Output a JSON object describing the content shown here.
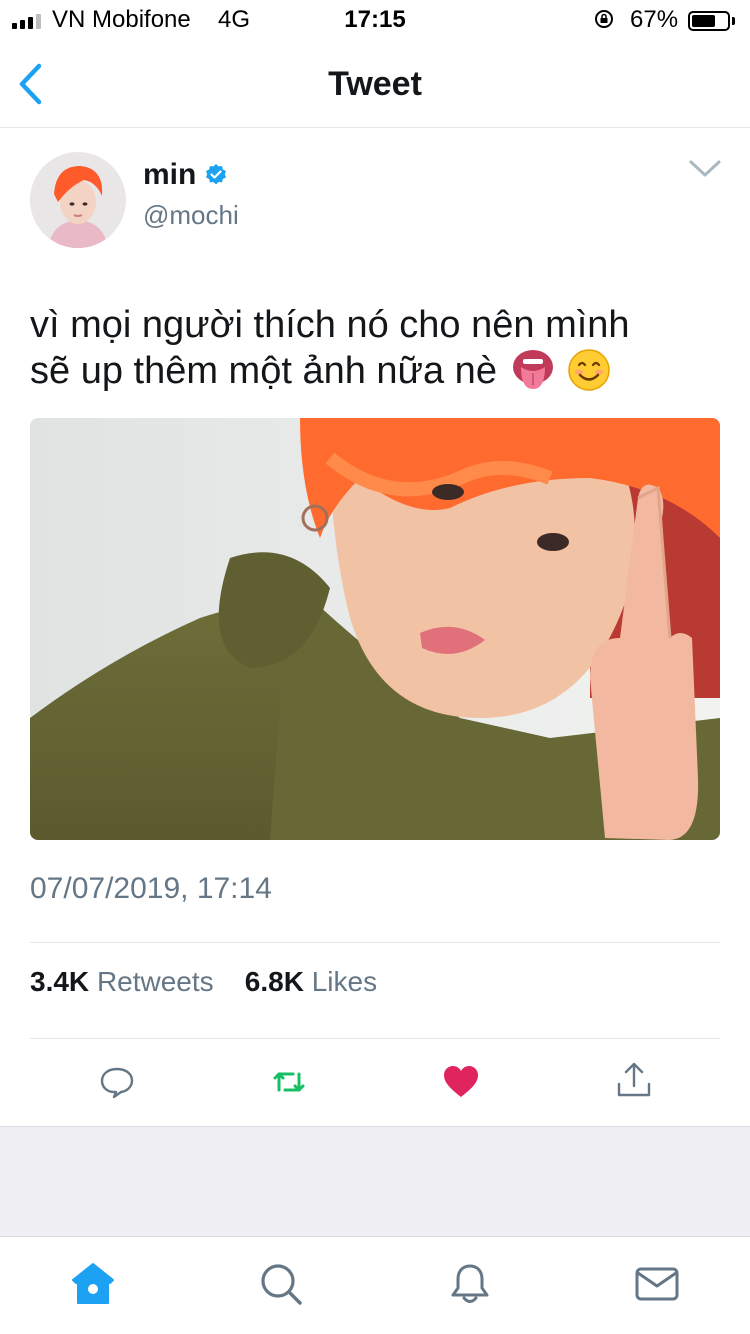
{
  "status_bar": {
    "carrier": "VN Mobifone",
    "network": "4G",
    "time": "17:15",
    "battery_percent": "67%",
    "battery_level": 0.67,
    "icons": [
      "signal-icon",
      "rotation-lock-icon",
      "battery-icon"
    ]
  },
  "nav": {
    "title": "Tweet",
    "back_icon": "chevron-left-icon"
  },
  "author": {
    "name": "min",
    "handle": "@mochi",
    "verified": true,
    "menu_icon": "chevron-down-icon"
  },
  "tweet": {
    "text_line1": "vì mọi người thích nó cho nên mình",
    "text_line2": "sẽ up thêm một ảnh nữa nè",
    "emojis": [
      "tongue-face-emoji",
      "smiling-face-emoji"
    ],
    "timestamp": "07/07/2019, 17:14"
  },
  "stats": {
    "retweets_count": "3.4K",
    "retweets_label": "Retweets",
    "likes_count": "6.8K",
    "likes_label": "Likes"
  },
  "actions": [
    {
      "icon": "reply-icon"
    },
    {
      "icon": "retweet-icon",
      "color": "#17bf63"
    },
    {
      "icon": "heart-icon",
      "color": "#e0245e"
    },
    {
      "icon": "share-icon"
    }
  ],
  "tab_bar": [
    {
      "icon": "home-icon",
      "active": true,
      "color": "#1da1f2"
    },
    {
      "icon": "search-icon"
    },
    {
      "icon": "notifications-bell-icon"
    },
    {
      "icon": "messages-envelope-icon"
    }
  ],
  "colors": {
    "accent": "#1da1f2",
    "text": "#14171a",
    "secondary": "#657786",
    "like": "#e0245e",
    "retweet": "#17bf63"
  }
}
